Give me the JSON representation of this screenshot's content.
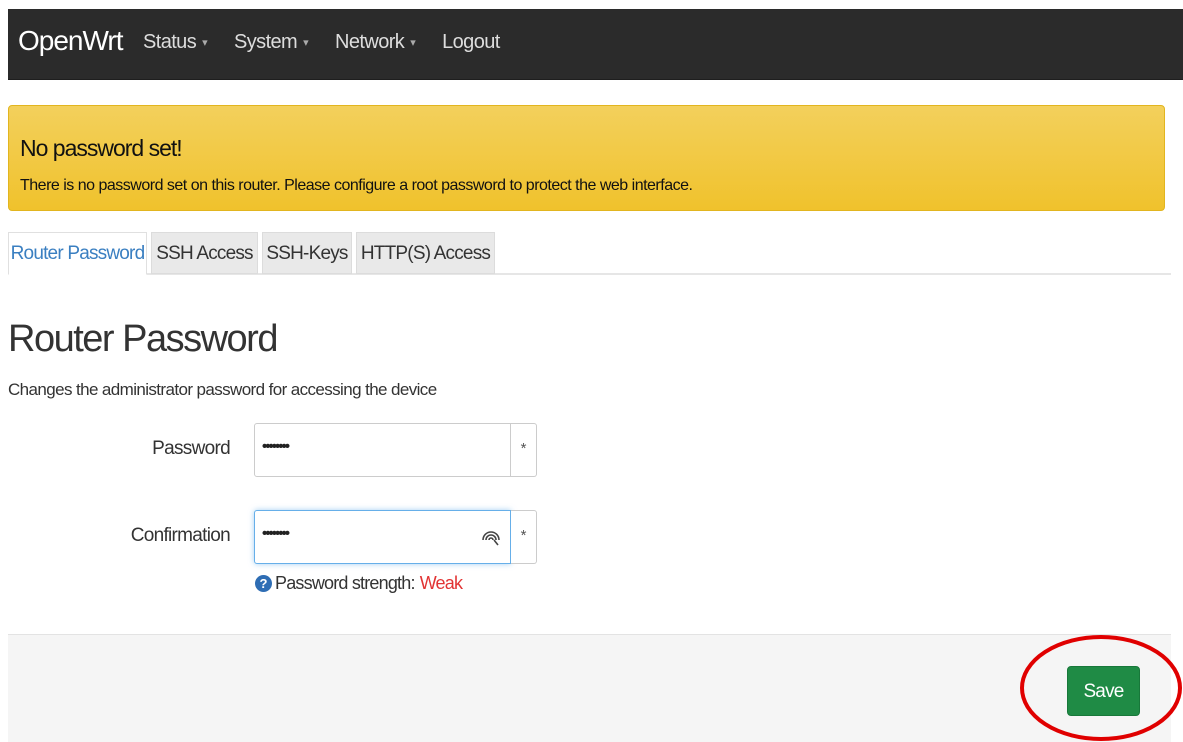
{
  "navbar": {
    "brand": "OpenWrt",
    "menu": [
      {
        "label": "Status",
        "has_dropdown": true
      },
      {
        "label": "System",
        "has_dropdown": true
      },
      {
        "label": "Network",
        "has_dropdown": true
      },
      {
        "label": "Logout",
        "has_dropdown": false
      }
    ],
    "caret": "▾"
  },
  "alert": {
    "title": "No password set!",
    "text": "There is no password set on this router. Please configure a root password to protect the web interface."
  },
  "tabs": [
    {
      "label": "Router Password",
      "active": true
    },
    {
      "label": "SSH Access",
      "active": false
    },
    {
      "label": "SSH-Keys",
      "active": false
    },
    {
      "label": "HTTP(S) Access",
      "active": false
    }
  ],
  "section": {
    "title": "Router Password",
    "description": "Changes the administrator password for accessing the device"
  },
  "form": {
    "password": {
      "label": "Password",
      "value": "••••••••",
      "addon": "*"
    },
    "confirmation": {
      "label": "Confirmation",
      "value": "••••••••",
      "addon": "*"
    },
    "strength": {
      "label": "Password strength:",
      "value": "Weak",
      "help": "?"
    }
  },
  "actions": {
    "save_label": "Save"
  },
  "colors": {
    "navbar_bg": "#2b2b2b",
    "alert_bg": "#f0c22c",
    "active_tab": "#3a7fc1",
    "save_button": "#1f8b45",
    "strength_weak": "#e23434",
    "annotation_circle": "#e00000"
  }
}
